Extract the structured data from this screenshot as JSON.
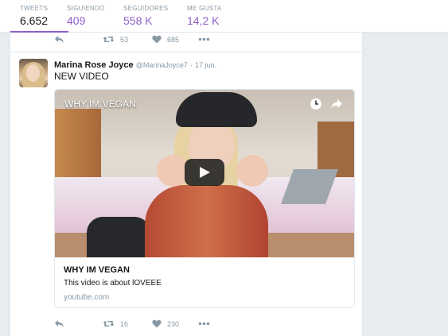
{
  "stats": [
    {
      "label": "TWEETS",
      "value": "6.652"
    },
    {
      "label": "SIGUIENDO",
      "value": "409"
    },
    {
      "label": "SEGUIDORES",
      "value": "558 K"
    },
    {
      "label": "ME GUSTA",
      "value": "14,2 K"
    }
  ],
  "prev_tweet_actions": {
    "retweets": "53",
    "likes": "685"
  },
  "tweet": {
    "name": "Marina Rose Joyce",
    "handle": "@MarinaJoyce7",
    "separator": "·",
    "time": "17 jun.",
    "text": "NEW VIDEO",
    "card": {
      "player_title": "WHY IM VEGAN",
      "title": "WHY IM VEGAN",
      "description": "This video is about lOVEEE",
      "url": "youtube.com"
    },
    "actions": {
      "retweets": "16",
      "likes": "230"
    }
  },
  "icons": {
    "reply": "reply-icon",
    "retweet": "retweet-icon",
    "like": "heart-icon",
    "more": "more-icon",
    "watch_later": "clock-icon",
    "share": "share-icon",
    "play": "play-icon"
  },
  "colors": {
    "accent": "#8e5fc8",
    "muted": "#8899a6",
    "page_bg": "#e6ecf0"
  }
}
